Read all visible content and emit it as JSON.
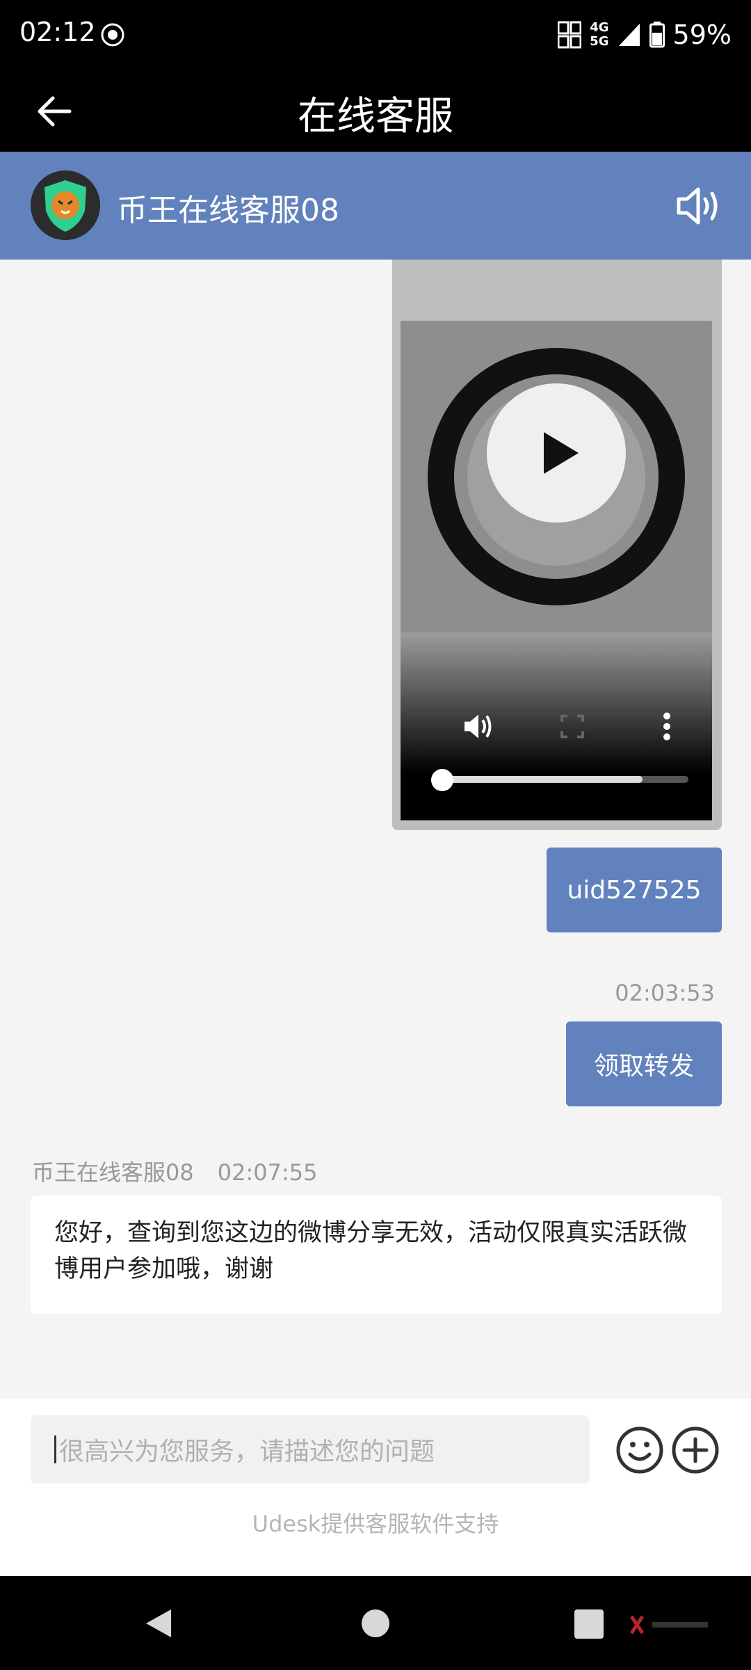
{
  "status_bar": {
    "time": "02:12",
    "network_top": "4G",
    "network_bottom": "5G",
    "battery": "59%"
  },
  "header": {
    "title": "在线客服"
  },
  "agent": {
    "name": "币王在线客服08"
  },
  "video": {
    "progress": 0.0
  },
  "messages": {
    "uid": "uid527525",
    "sent_time": "02:03:53",
    "claim": "领取转发",
    "reply_sender": "币王在线客服08",
    "reply_time": "02:07:55",
    "reply_text": "您好，查询到您这边的微博分享无效，活动仅限真实活跃微博用户参加哦，谢谢"
  },
  "input": {
    "placeholder": "很高兴为您服务，请描述您的问题"
  },
  "footer": {
    "powered_by": "Udesk提供客服软件支持"
  },
  "colors": {
    "accent": "#6182bd",
    "background": "#f4f4f4"
  },
  "icons": {
    "back": "arrow-left-icon",
    "speaker": "speaker-icon",
    "emoji": "smiley-icon",
    "add": "plus-circle-icon"
  }
}
